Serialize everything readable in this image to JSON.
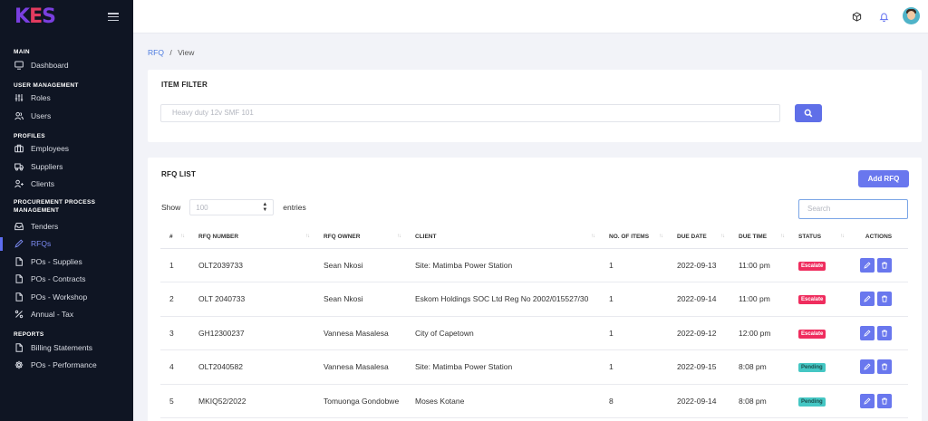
{
  "app": {
    "logo": [
      "K",
      "E",
      "S"
    ]
  },
  "sidebar": {
    "sections": [
      {
        "title": "MAIN",
        "items": [
          {
            "label": "Dashboard",
            "icon": "monitor-icon"
          }
        ]
      },
      {
        "title": "USER MANAGEMENT",
        "items": [
          {
            "label": "Roles",
            "icon": "sliders-icon"
          },
          {
            "label": "Users",
            "icon": "users-icon"
          }
        ]
      },
      {
        "title": "PROFILES",
        "items": [
          {
            "label": "Employees",
            "icon": "briefcase-icon"
          },
          {
            "label": "Suppliers",
            "icon": "truck-icon"
          },
          {
            "label": "Clients",
            "icon": "user-plus-icon"
          }
        ]
      },
      {
        "title": "PROCUREMENT PROCESS MANAGEMENT",
        "items": [
          {
            "label": "Tenders",
            "icon": "archive-icon"
          },
          {
            "label": "RFQs",
            "icon": "pen-icon"
          },
          {
            "label": "POs - Supplies",
            "icon": "file-icon"
          },
          {
            "label": "POs - Contracts",
            "icon": "file-icon"
          },
          {
            "label": "POs - Workshop",
            "icon": "file-icon"
          },
          {
            "label": "Annual - Tax",
            "icon": "percent-icon"
          }
        ]
      },
      {
        "title": "REPORTS",
        "items": [
          {
            "label": "Billing Statements",
            "icon": "file-icon"
          },
          {
            "label": "POs - Performance",
            "icon": "gear-icon"
          }
        ]
      }
    ]
  },
  "breadcrumb": {
    "link": "RFQ",
    "separator": "/",
    "current": "View"
  },
  "filter": {
    "title": "ITEM FILTER",
    "placeholder": "Heavy duty 12v SMF 101"
  },
  "list": {
    "title": "RFQ LIST",
    "add_label": "Add RFQ",
    "show_label": "Show",
    "entries_value": "100",
    "entries_label": "entries",
    "search_placeholder": "Search",
    "columns": [
      "#",
      "RFQ NUMBER",
      "RFQ OWNER",
      "CLIENT",
      "NO. OF ITEMS",
      "DUE DATE",
      "DUE TIME",
      "STATUS",
      "ACTIONS"
    ],
    "rows": [
      {
        "num": "1",
        "rfq": "OLT2039733",
        "owner": "Sean Nkosi",
        "client": "Site: Matimba Power Station",
        "items": "1",
        "date": "2022-09-13",
        "time": "11:00 pm",
        "status": "Escalate"
      },
      {
        "num": "2",
        "rfq": "OLT 2040733",
        "owner": "Sean Nkosi",
        "client": "Eskom Holdings SOC Ltd Reg No 2002/015527/30",
        "items": "1",
        "date": "2022-09-14",
        "time": "11:00 pm",
        "status": "Escalate"
      },
      {
        "num": "3",
        "rfq": "GH12300237",
        "owner": "Vannesa Masalesa",
        "client": "City of Capetown",
        "items": "1",
        "date": "2022-09-12",
        "time": "12:00 pm",
        "status": "Escalate"
      },
      {
        "num": "4",
        "rfq": "OLT2040582",
        "owner": "Vannesa Masalesa",
        "client": "Site: Matimba Power Station",
        "items": "1",
        "date": "2022-09-15",
        "time": "8:08 pm",
        "status": "Pending"
      },
      {
        "num": "5",
        "rfq": "MKIQ52/2022",
        "owner": "Tomuonga Gondobwe",
        "client": "Moses Kotane",
        "items": "8",
        "date": "2022-09-14",
        "time": "8:08 pm",
        "status": "Pending"
      }
    ]
  },
  "colors": {
    "escalate": "#ef2d5e",
    "pending": "#45c7c4",
    "accent": "#6977ee",
    "sidebar_bg": "#0f1523"
  }
}
